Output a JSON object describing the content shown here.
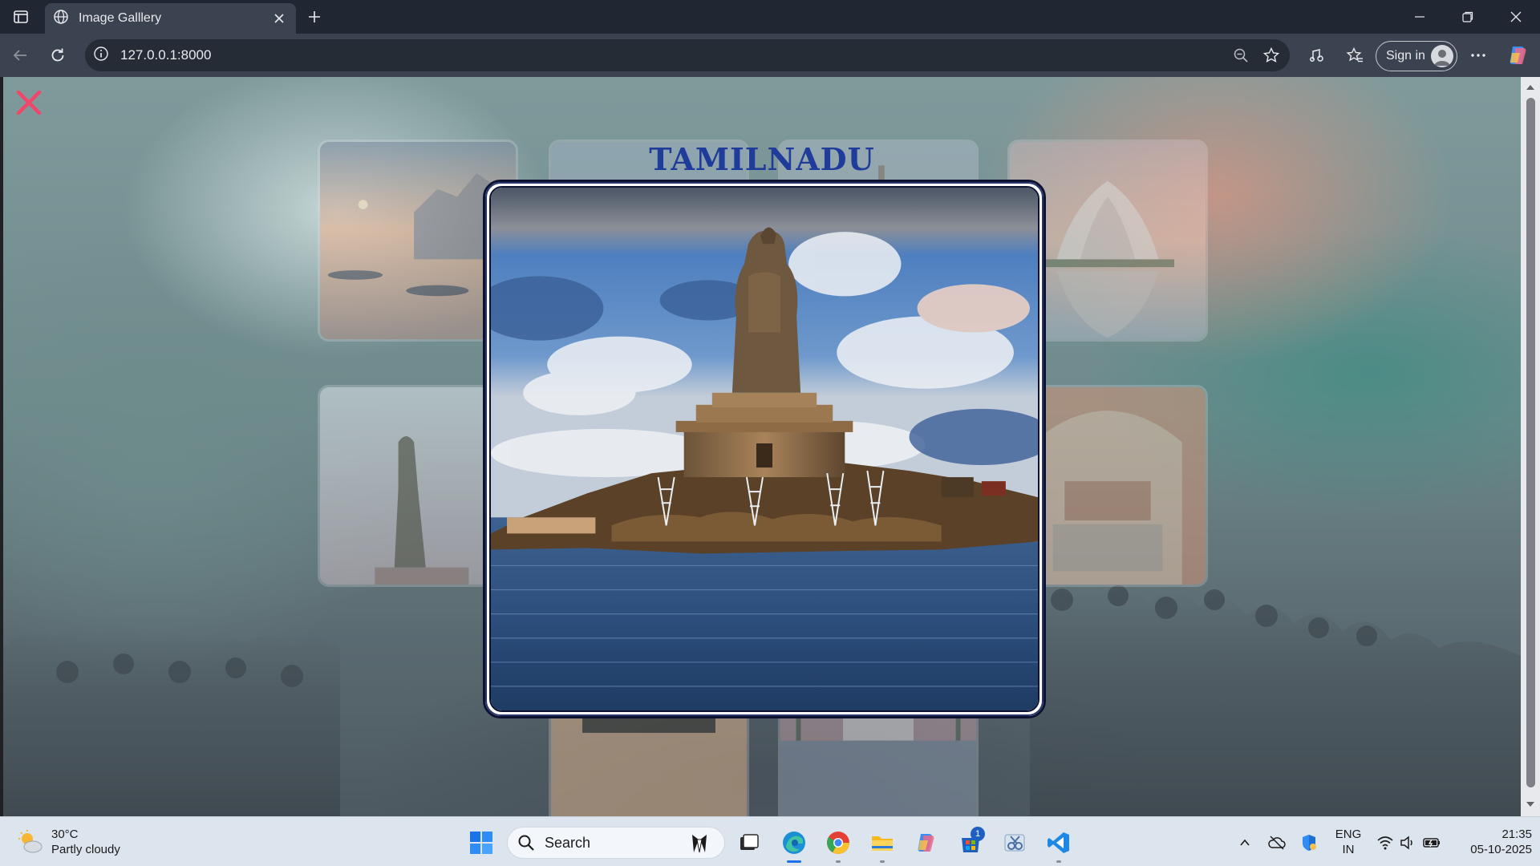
{
  "browser": {
    "tab_title": "Image Galllery",
    "url": "127.0.0.1:8000",
    "sign_in_label": "Sign in"
  },
  "page": {
    "gallery_title": "TAMILNADU",
    "close_icon": "close-x-icon",
    "accent_close": "#f0476a",
    "title_color": "#1f3c9a",
    "thumbnails": [
      {
        "name": "varanasi-ghats",
        "colors": [
          "#f2b38d",
          "#c59a8c",
          "#7d8c9c"
        ]
      },
      {
        "name": "gallery-tile-2",
        "colors": [
          "#b9c9d6",
          "#9fb0c0",
          "#7f92a5"
        ]
      },
      {
        "name": "gallery-tile-3",
        "colors": [
          "#c8d2dc",
          "#a9b6c4",
          "#8e9db0"
        ]
      },
      {
        "name": "lotus-temple",
        "colors": [
          "#eec7b4",
          "#cfa594",
          "#aab5c4"
        ]
      },
      {
        "name": "statue-of-unity",
        "colors": [
          "#dde3ea",
          "#c4b9bf",
          "#8c8f99"
        ]
      },
      {
        "name": "hawa-mahal",
        "colors": [
          "#e8b095",
          "#d39578",
          "#b58673"
        ]
      },
      {
        "name": "kerala-houseboat",
        "colors": [
          "#9fbf7a",
          "#d3a47a",
          "#c7a06a"
        ]
      },
      {
        "name": "taj-mahal",
        "colors": [
          "#e3b8aa",
          "#b89aa0",
          "#8693a6"
        ]
      }
    ]
  },
  "taskbar": {
    "weather_temp": "30°C",
    "weather_desc": "Partly cloudy",
    "search_label": "Search",
    "store_badge": "1",
    "lang_line1": "ENG",
    "lang_line2": "IN",
    "time": "21:35",
    "date": "05-10-2025"
  }
}
